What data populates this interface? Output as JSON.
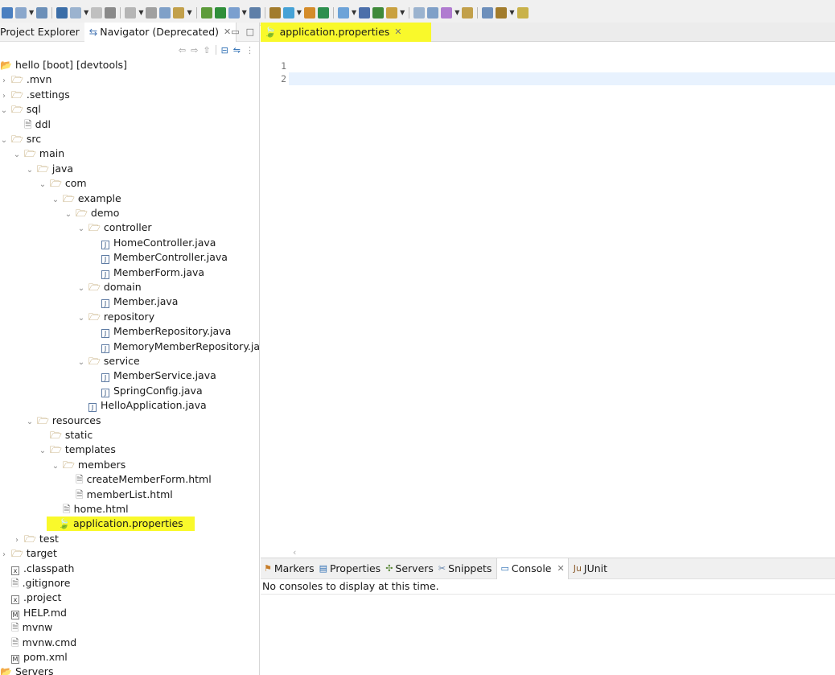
{
  "colors": {
    "highlight": "#f9f92b",
    "current_line": "#e8f2fe",
    "folder": "#a27c2c",
    "leaf": "#66aa33"
  },
  "views": {
    "project_explorer": "Project Explorer",
    "navigator": "Navigator (Deprecated)"
  },
  "tree": [
    {
      "label": "hello [boot] [devtools]",
      "icon": "project-icon",
      "depth": 0,
      "twisty": "",
      "type": "project"
    },
    {
      "label": ".mvn",
      "icon": "folder-icon",
      "depth": 0,
      "twisty": "closed",
      "type": "folder"
    },
    {
      "label": ".settings",
      "icon": "folder-icon",
      "depth": 0,
      "twisty": "closed",
      "type": "folder"
    },
    {
      "label": "sql",
      "icon": "folder-icon",
      "depth": 0,
      "twisty": "open",
      "type": "folder"
    },
    {
      "label": "ddl",
      "icon": "file-icon",
      "depth": 1,
      "twisty": "",
      "type": "file"
    },
    {
      "label": "src",
      "icon": "folder-icon",
      "depth": 0,
      "twisty": "open",
      "type": "folder"
    },
    {
      "label": "main",
      "icon": "folder-icon",
      "depth": 1,
      "twisty": "open",
      "type": "folder"
    },
    {
      "label": "java",
      "icon": "folder-icon",
      "depth": 2,
      "twisty": "open",
      "type": "folder"
    },
    {
      "label": "com",
      "icon": "folder-icon",
      "depth": 3,
      "twisty": "open",
      "type": "folder"
    },
    {
      "label": "example",
      "icon": "folder-icon",
      "depth": 4,
      "twisty": "open",
      "type": "folder"
    },
    {
      "label": "demo",
      "icon": "folder-icon",
      "depth": 5,
      "twisty": "open",
      "type": "folder"
    },
    {
      "label": "controller",
      "icon": "folder-icon",
      "depth": 6,
      "twisty": "open",
      "type": "folder"
    },
    {
      "label": "HomeController.java",
      "icon": "java-file-icon",
      "depth": 7,
      "twisty": "",
      "type": "java"
    },
    {
      "label": "MemberController.java",
      "icon": "java-file-icon",
      "depth": 7,
      "twisty": "",
      "type": "java"
    },
    {
      "label": "MemberForm.java",
      "icon": "java-file-icon",
      "depth": 7,
      "twisty": "",
      "type": "java"
    },
    {
      "label": "domain",
      "icon": "folder-icon",
      "depth": 6,
      "twisty": "open",
      "type": "folder"
    },
    {
      "label": "Member.java",
      "icon": "java-file-icon",
      "depth": 7,
      "twisty": "",
      "type": "java"
    },
    {
      "label": "repository",
      "icon": "folder-icon",
      "depth": 6,
      "twisty": "open",
      "type": "folder"
    },
    {
      "label": "MemberRepository.java",
      "icon": "java-file-icon",
      "depth": 7,
      "twisty": "",
      "type": "java"
    },
    {
      "label": "MemoryMemberRepository.java",
      "icon": "java-file-icon",
      "depth": 7,
      "twisty": "",
      "type": "java"
    },
    {
      "label": "service",
      "icon": "folder-icon",
      "depth": 6,
      "twisty": "open",
      "type": "folder"
    },
    {
      "label": "MemberService.java",
      "icon": "java-file-icon",
      "depth": 7,
      "twisty": "",
      "type": "java"
    },
    {
      "label": "SpringConfig.java",
      "icon": "java-file-icon",
      "depth": 7,
      "twisty": "",
      "type": "java"
    },
    {
      "label": "HelloApplication.java",
      "icon": "java-file-icon",
      "depth": 6,
      "twisty": "",
      "type": "java"
    },
    {
      "label": "resources",
      "icon": "folder-icon",
      "depth": 2,
      "twisty": "open",
      "type": "folder"
    },
    {
      "label": "static",
      "icon": "folder-icon",
      "depth": 3,
      "twisty": "",
      "type": "folder"
    },
    {
      "label": "templates",
      "icon": "folder-icon",
      "depth": 3,
      "twisty": "open",
      "type": "folder"
    },
    {
      "label": "members",
      "icon": "folder-icon",
      "depth": 4,
      "twisty": "open",
      "type": "folder"
    },
    {
      "label": "createMemberForm.html",
      "icon": "file-icon",
      "depth": 5,
      "twisty": "",
      "type": "file"
    },
    {
      "label": "memberList.html",
      "icon": "file-icon",
      "depth": 5,
      "twisty": "",
      "type": "file"
    },
    {
      "label": "home.html",
      "icon": "file-icon",
      "depth": 4,
      "twisty": "",
      "type": "file"
    },
    {
      "label": "application.properties",
      "icon": "properties-file-icon",
      "depth": 3,
      "twisty": "",
      "type": "props",
      "highlight": true
    },
    {
      "label": "test",
      "icon": "folder-icon",
      "depth": 1,
      "twisty": "closed",
      "type": "folder"
    },
    {
      "label": "target",
      "icon": "folder-icon",
      "depth": 0,
      "twisty": "closed",
      "type": "folder"
    },
    {
      "label": ".classpath",
      "icon": "xml-file-icon",
      "depth": 0,
      "twisty": "",
      "type": "xml"
    },
    {
      "label": ".gitignore",
      "icon": "file-icon",
      "depth": 0,
      "twisty": "",
      "type": "file"
    },
    {
      "label": ".project",
      "icon": "xml-file-icon",
      "depth": 0,
      "twisty": "",
      "type": "xml"
    },
    {
      "label": "HELP.md",
      "icon": "markdown-file-icon",
      "depth": 0,
      "twisty": "",
      "type": "md"
    },
    {
      "label": "mvnw",
      "icon": "file-icon",
      "depth": 0,
      "twisty": "",
      "type": "file"
    },
    {
      "label": "mvnw.cmd",
      "icon": "file-icon",
      "depth": 0,
      "twisty": "",
      "type": "file"
    },
    {
      "label": "pom.xml",
      "icon": "maven-file-icon",
      "depth": 0,
      "twisty": "",
      "type": "md"
    },
    {
      "label": "Servers",
      "icon": "project-icon",
      "depth": 0,
      "twisty": "",
      "type": "project"
    }
  ],
  "editor": {
    "tab_label": "application.properties",
    "line_numbers": [
      "1",
      "2"
    ]
  },
  "bottom": {
    "tabs": [
      {
        "label": "Markers",
        "icon": "markers-icon"
      },
      {
        "label": "Properties",
        "icon": "properties-icon"
      },
      {
        "label": "Servers",
        "icon": "servers-icon"
      },
      {
        "label": "Snippets",
        "icon": "snippets-icon"
      },
      {
        "label": "Console",
        "icon": "console-icon",
        "active": true
      },
      {
        "label": "JUnit",
        "icon": "junit-icon"
      }
    ],
    "console_message": "No consoles to display at this time."
  }
}
